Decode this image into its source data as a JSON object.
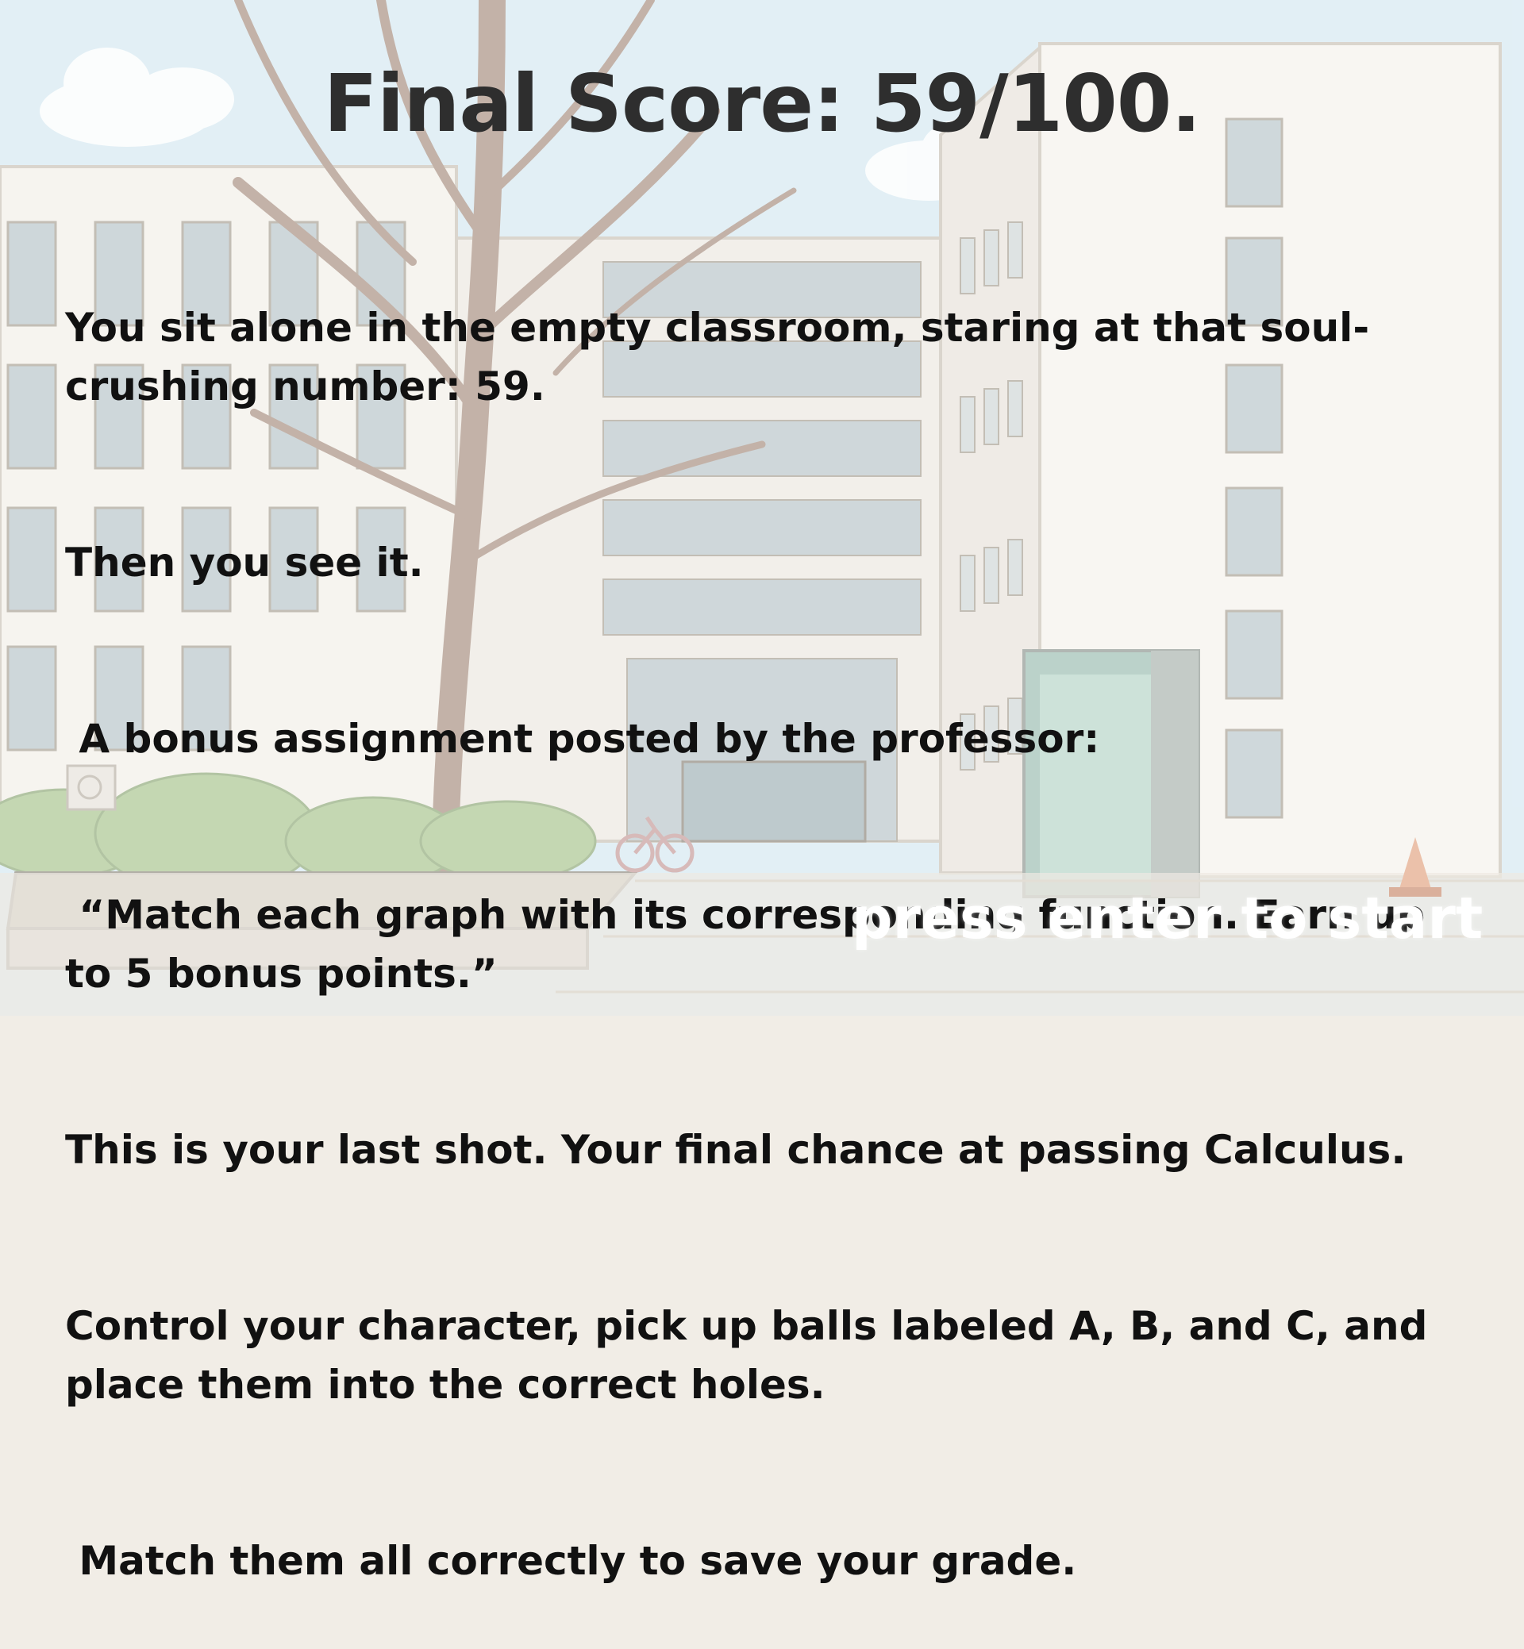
{
  "title": "Final Score: 59/100.",
  "story": {
    "line1": "You sit alone in the empty classroom, staring at that soul-crushing number: 59.",
    "line2": "Then you see it.",
    "line3": " A bonus assignment posted by the professor:",
    "line4": " “Match each graph with its corresponding function. Earn up to 5 bonus points.”",
    "line5": "This is your last shot. Your final chance at passing Calculus.",
    "line6": "Control your character, pick up balls labeled A, B, and C, and place them into the correct holes.",
    "line7": " Match them all correctly to save your grade."
  },
  "prompt": "press enter to start",
  "colors": {
    "sky": "#cfe6f0",
    "building": "#f3f0ea",
    "window": "#b9c7cc",
    "tree": "#a88f80",
    "bush": "#a7c48a",
    "ground": "#e8e1d8",
    "title": "#2e2e2e",
    "text": "#111111",
    "prompt": "#ffffff"
  }
}
